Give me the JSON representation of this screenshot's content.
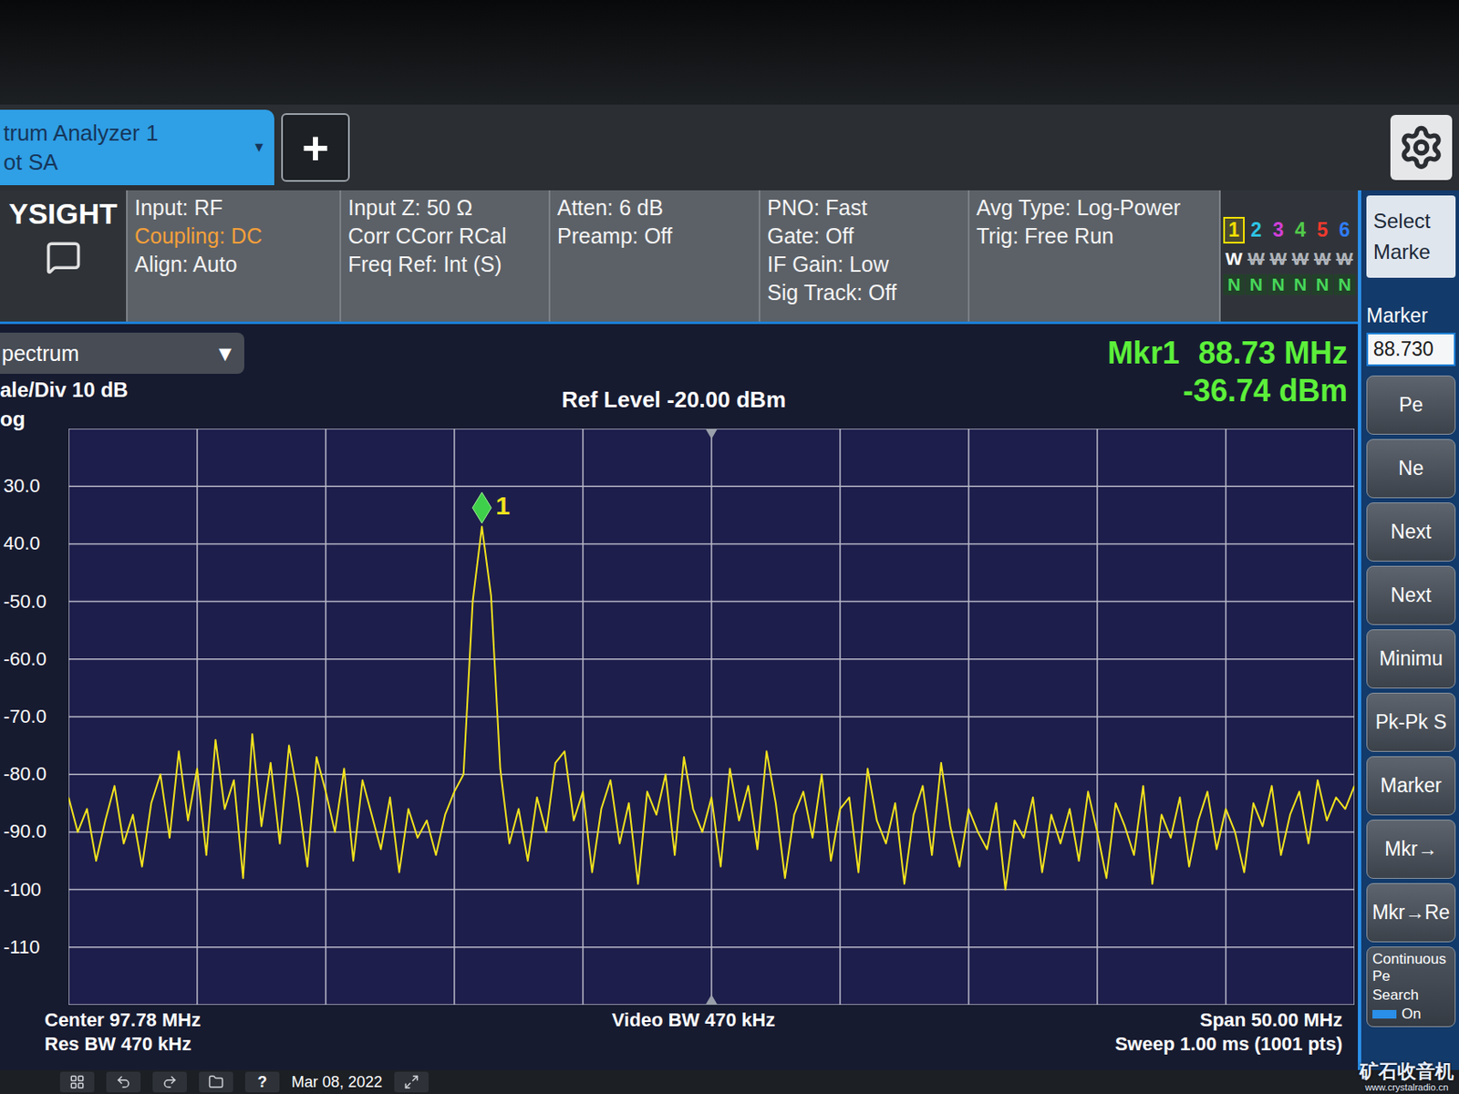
{
  "tab": {
    "lines": [
      "trum Analyzer 1",
      "ot SA"
    ],
    "arrow": "▼"
  },
  "new_tab_button": "+",
  "brand": "YSIGHT",
  "status_columns": [
    [
      {
        "text": "Input: RF",
        "warning": false
      },
      {
        "text": "Coupling: DC",
        "warning": true
      },
      {
        "text": "Align: Auto",
        "warning": false
      }
    ],
    [
      {
        "text": "Input Z: 50 Ω",
        "warning": false
      },
      {
        "text": "Corr CCorr RCal",
        "warning": false
      },
      {
        "text": "Freq Ref: Int (S)",
        "warning": false
      }
    ],
    [
      {
        "text": "Atten: 6 dB",
        "warning": false
      },
      {
        "text": "Preamp: Off",
        "warning": false
      }
    ],
    [
      {
        "text": "PNO: Fast",
        "warning": false
      },
      {
        "text": "Gate: Off",
        "warning": false
      },
      {
        "text": "IF Gain: Low",
        "warning": false
      },
      {
        "text": "Sig Track: Off",
        "warning": false
      }
    ],
    [
      {
        "text": "Avg Type: Log-Power",
        "warning": false
      },
      {
        "text": "Trig: Free Run",
        "warning": false
      }
    ]
  ],
  "traces": [
    {
      "number": "1",
      "color": "#f5e000",
      "selected": true,
      "mode": "W",
      "mode_active": true,
      "detector": "N"
    },
    {
      "number": "2",
      "color": "#2ec4e6",
      "selected": false,
      "mode": "W",
      "mode_active": false,
      "detector": "N"
    },
    {
      "number": "3",
      "color": "#d23fd8",
      "selected": false,
      "mode": "W",
      "mode_active": false,
      "detector": "N"
    },
    {
      "number": "4",
      "color": "#52c94a",
      "selected": false,
      "mode": "W",
      "mode_active": false,
      "detector": "N"
    },
    {
      "number": "5",
      "color": "#f03a2e",
      "selected": false,
      "mode": "W",
      "mode_active": false,
      "detector": "N"
    },
    {
      "number": "6",
      "color": "#2f7cf5",
      "selected": false,
      "mode": "W",
      "mode_active": false,
      "detector": "N"
    }
  ],
  "softkeys": {
    "select": [
      "Select",
      "Marke"
    ],
    "marker_label": "Marker",
    "marker_value": "88.730",
    "buttons": [
      "Pe",
      "Ne",
      "Next",
      "Next",
      "Minimu",
      "Pk-Pk S",
      "Marker",
      "Mkr→",
      "Mkr→Re"
    ],
    "continuous": {
      "lines": [
        "Continuous Pe",
        "Search"
      ],
      "toggle": "On",
      "on": true
    }
  },
  "view": {
    "label": "pectrum",
    "arrow": "▼"
  },
  "scale": "ale/Div 10 dB",
  "scale_type": "og",
  "ref_level": "Ref Level -20.00 dBm",
  "marker_readout": {
    "name": "Mkr1",
    "frequency": "88.73 MHz",
    "amplitude": "-36.74 dBm"
  },
  "chart": {
    "y_max": -20,
    "y_min": -120,
    "y_ticks": [
      {
        "label": "30.0",
        "value": -30
      },
      {
        "label": "40.0",
        "value": -40
      },
      {
        "label": "-50.0",
        "value": -50
      },
      {
        "label": "-60.0",
        "value": -60
      },
      {
        "label": "-70.0",
        "value": -70
      },
      {
        "label": "-80.0",
        "value": -80
      },
      {
        "label": "-90.0",
        "value": -90
      },
      {
        "label": "-100",
        "value": -100
      },
      {
        "label": "-110",
        "value": -110
      }
    ],
    "series": [
      {
        "name": "Trace 1",
        "color": "#f2e21e",
        "values": [
          -84,
          -90,
          -86,
          -95,
          -88,
          -82,
          -92,
          -87,
          -96,
          -85,
          -80,
          -91,
          -76,
          -88,
          -79,
          -94,
          -74,
          -86,
          -81,
          -98,
          -73,
          -89,
          -78,
          -92,
          -75,
          -84,
          -96,
          -77,
          -83,
          -90,
          -79,
          -95,
          -81,
          -87,
          -93,
          -84,
          -97,
          -86,
          -91,
          -88,
          -94,
          -87,
          -83,
          -80,
          -50,
          -37,
          -49,
          -79,
          -92,
          -86,
          -95,
          -84,
          -90,
          -78,
          -76,
          -88,
          -83,
          -97,
          -86,
          -81,
          -92,
          -85,
          -99,
          -83,
          -87,
          -80,
          -94,
          -77,
          -86,
          -90,
          -84,
          -96,
          -79,
          -88,
          -82,
          -93,
          -76,
          -85,
          -98,
          -87,
          -83,
          -91,
          -80,
          -95,
          -86,
          -84,
          -97,
          -79,
          -88,
          -92,
          -85,
          -99,
          -87,
          -82,
          -94,
          -78,
          -89,
          -96,
          -86,
          -90,
          -93,
          -85,
          -100,
          -88,
          -91,
          -84,
          -97,
          -87,
          -92,
          -86,
          -95,
          -83,
          -90,
          -98,
          -85,
          -89,
          -94,
          -82,
          -99,
          -87,
          -91,
          -84,
          -96,
          -88,
          -83,
          -93,
          -86,
          -90,
          -97,
          -85,
          -89,
          -82,
          -94,
          -87,
          -83,
          -92,
          -81,
          -88,
          -84,
          -86,
          -82
        ]
      }
    ],
    "marker": {
      "label": "1",
      "color": "#3ed04a"
    }
  },
  "footer": {
    "left": [
      "Center 97.78 MHz",
      "Res BW 470 kHz"
    ],
    "center": "Video BW 470 kHz",
    "right": [
      "Span 50.00 MHz",
      "Sweep 1.00 ms (1001 pts)"
    ]
  },
  "taskbar": {
    "help": "?",
    "date": "Mar 08, 2022"
  },
  "watermark": {
    "name": "矿石收音机",
    "url": "www.crystalradio.cn"
  }
}
